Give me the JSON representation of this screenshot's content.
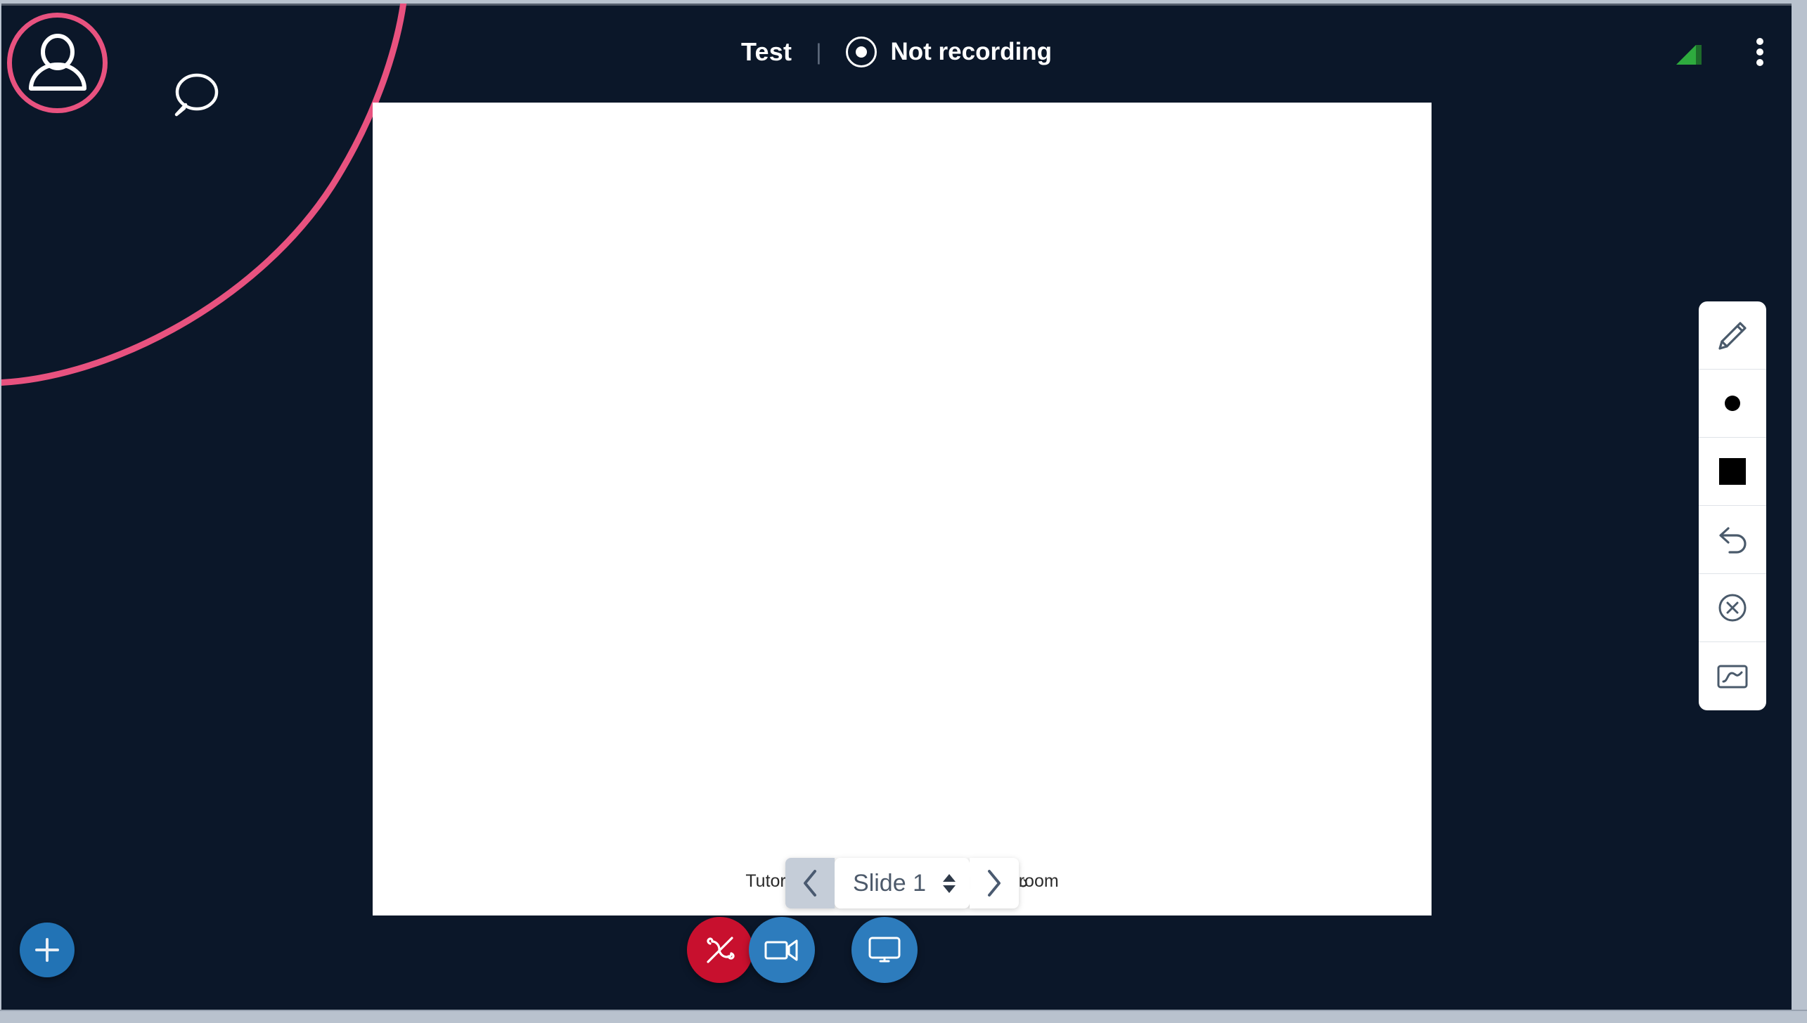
{
  "app": {
    "background_color": "#0b1729",
    "chrome_color": "#b9c2ce",
    "accent_pink": "#e8527f",
    "accent_blue": "#2d7cbd",
    "danger_red": "#c8102e",
    "signal_green": "#2eab3e"
  },
  "header": {
    "meeting_title": "Test",
    "separator": "|",
    "recording_status": "Not recording",
    "record_icon": "record-dot-icon",
    "signal_icon": "signal-strength-icon",
    "menu_icon": "kebab-menu-icon"
  },
  "presenter": {
    "avatar_icon": "person-avatar-icon",
    "chat_icon": "chat-bubble-icon"
  },
  "slide": {
    "footer_left": "Tutorials/Tutoriales/Anleitungen/دليل",
    "footer_right": "eeu.com/virtualclassroom",
    "nav": {
      "prev_icon": "chevron-left-icon",
      "next_icon": "chevron-right-icon",
      "current_label": "Slide 1",
      "spinner_icon": "updown-spinner-icon",
      "options": [
        "Slide 1"
      ]
    }
  },
  "whiteboard_tools": [
    {
      "name": "pencil-tool",
      "icon": "pencil-icon",
      "label": "Pencil"
    },
    {
      "name": "thickness-tool",
      "icon": "dot-icon",
      "label": "Thickness"
    },
    {
      "name": "color-tool",
      "icon": "color-swatch-icon",
      "label": "Color",
      "color": "#000000"
    },
    {
      "name": "undo-tool",
      "icon": "undo-arrow-icon",
      "label": "Undo"
    },
    {
      "name": "clear-tool",
      "icon": "clear-circle-x-icon",
      "label": "Clear all"
    },
    {
      "name": "multiuser-tool",
      "icon": "whiteboard-icon",
      "label": "Multi-user whiteboard"
    }
  ],
  "actions": [
    {
      "name": "add-button",
      "icon": "plus-icon",
      "label": "Add",
      "color": "#2273b5"
    },
    {
      "name": "leave-audio-button",
      "icon": "phone-slash-icon",
      "label": "Leave audio",
      "color": "#c8102e"
    },
    {
      "name": "camera-button",
      "icon": "video-camera-icon",
      "label": "Share webcam",
      "color": "#2d7cbd"
    },
    {
      "name": "screenshare-button",
      "icon": "screen-monitor-icon",
      "label": "Share screen",
      "color": "#2d7cbd"
    }
  ]
}
